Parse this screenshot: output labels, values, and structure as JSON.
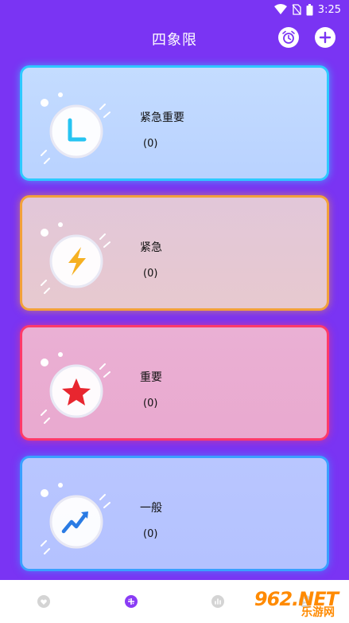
{
  "status_bar": {
    "time": "3:25"
  },
  "app_bar": {
    "title": "四象限"
  },
  "quadrants": [
    {
      "label": "紧急重要",
      "count": "(0)",
      "icon": "clock-icon",
      "border_color": "#2ec9ff"
    },
    {
      "label": "紧急",
      "count": "(0)",
      "icon": "lightning-icon",
      "border_color": "#f2a13b"
    },
    {
      "label": "重要",
      "count": "(0)",
      "icon": "star-icon",
      "border_color": "#ff3a6a"
    },
    {
      "label": "一般",
      "count": "(0)",
      "icon": "trend-up-icon",
      "border_color": "#3aa0ff"
    }
  ],
  "bottom_nav": {
    "items": [
      {
        "icon": "heart-icon",
        "active": false
      },
      {
        "icon": "grid-icon",
        "active": true
      },
      {
        "icon": "chart-icon",
        "active": false
      },
      {
        "icon": "profile-icon",
        "active": false
      }
    ]
  },
  "watermark": {
    "brand": "962.NET",
    "sub": "乐游网"
  },
  "colors": {
    "background": "#7a34f3",
    "accent": "#8a3cf5"
  }
}
